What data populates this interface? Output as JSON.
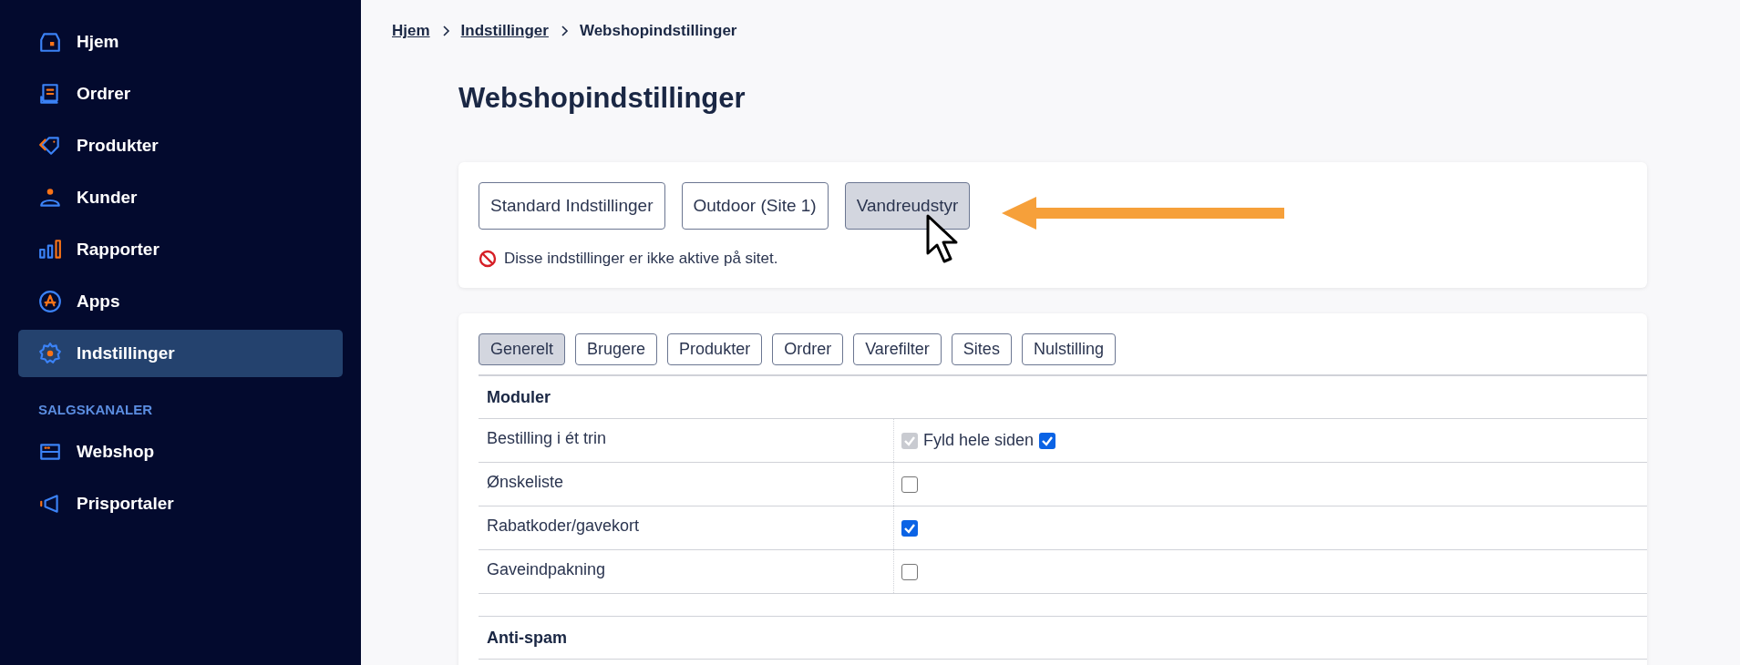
{
  "sidebar": {
    "items": [
      {
        "label": "Hjem",
        "selected": false
      },
      {
        "label": "Ordrer",
        "selected": false
      },
      {
        "label": "Produkter",
        "selected": false
      },
      {
        "label": "Kunder",
        "selected": false
      },
      {
        "label": "Rapporter",
        "selected": false
      },
      {
        "label": "Apps",
        "selected": false
      },
      {
        "label": "Indstillinger",
        "selected": true
      }
    ],
    "section": {
      "title": "SALGSKANALER",
      "items": [
        {
          "label": "Webshop",
          "selected": false
        },
        {
          "label": "Prisportaler",
          "selected": false
        }
      ]
    }
  },
  "breadcrumb": [
    {
      "label": "Hjem",
      "link": true
    },
    {
      "label": "Indstillinger",
      "link": true
    },
    {
      "label": "Webshopindstillinger",
      "link": false
    }
  ],
  "title": "Webshopindstillinger",
  "sites": {
    "buttons": [
      {
        "label": "Standard Indstillinger",
        "selected": false
      },
      {
        "label": "Outdoor (Site 1)",
        "selected": false
      },
      {
        "label": "Vandreudstyr",
        "selected": true
      }
    ],
    "notice": "Disse indstillinger er ikke aktive på sitet."
  },
  "tabs": [
    {
      "label": "Generelt",
      "selected": true
    },
    {
      "label": "Brugere",
      "selected": false
    },
    {
      "label": "Produkter",
      "selected": false
    },
    {
      "label": "Ordrer",
      "selected": false
    },
    {
      "label": "Varefilter",
      "selected": false
    },
    {
      "label": "Sites",
      "selected": false
    },
    {
      "label": "Nulstilling",
      "selected": false
    }
  ],
  "sections": [
    {
      "title": "Moduler",
      "rows": [
        {
          "label": "Bestilling i ét trin",
          "checked": true,
          "disabled": true,
          "option": {
            "label": "Fyld hele siden",
            "checked": true
          }
        },
        {
          "label": "Ønskeliste",
          "checked": false,
          "disabled": false
        },
        {
          "label": "Rabatkoder/gavekort",
          "checked": true,
          "disabled": false
        },
        {
          "label": "Gaveindpakning",
          "checked": false,
          "disabled": false
        }
      ]
    },
    {
      "title": "Anti-spam"
    }
  ]
}
